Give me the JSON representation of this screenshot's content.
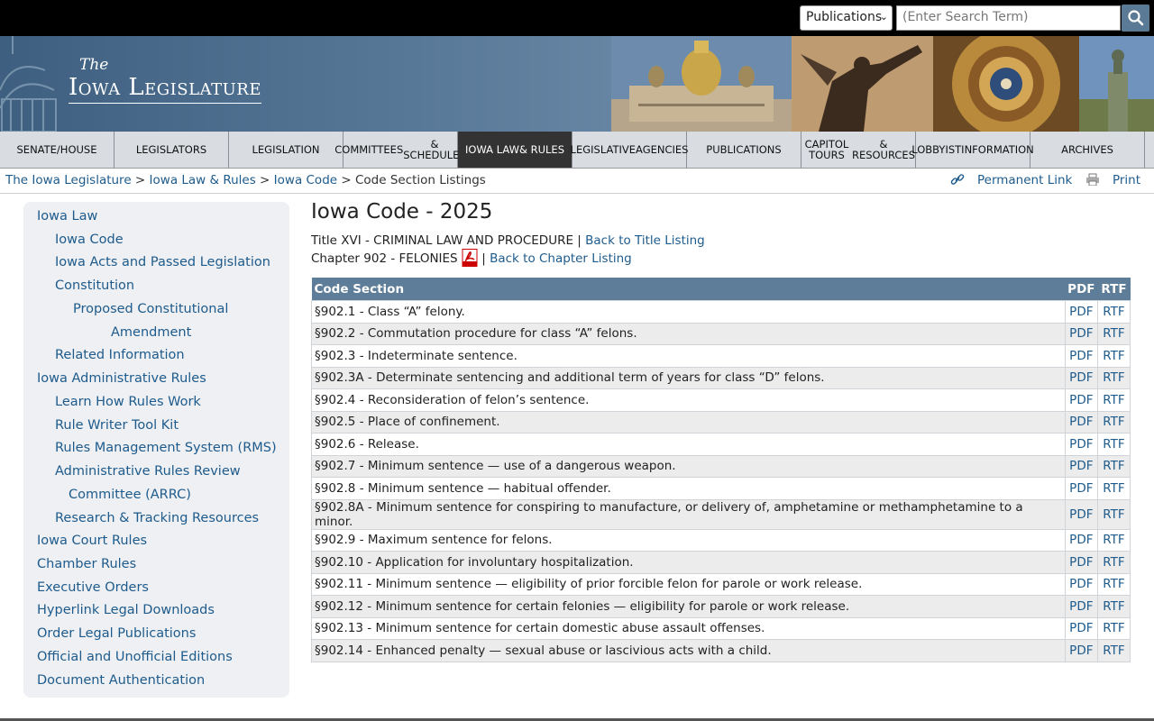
{
  "search": {
    "category": "Publications",
    "placeholder": "(Enter Search Term)"
  },
  "banner": {
    "logo_the": "The",
    "logo_main": "Iowa Legislature"
  },
  "nav": [
    {
      "line1": "Senate/House",
      "line2": ""
    },
    {
      "line1": "Legislators",
      "line2": ""
    },
    {
      "line1": "Legislation",
      "line2": ""
    },
    {
      "line1": "Committees",
      "line2": "& Schedules"
    },
    {
      "line1": "Iowa Law",
      "line2": "& Rules"
    },
    {
      "line1": "Legislative",
      "line2": "Agencies"
    },
    {
      "line1": "Publications",
      "line2": ""
    },
    {
      "line1": "Capitol Tours",
      "line2": "& Resources"
    },
    {
      "line1": "Lobbyist",
      "line2": "Information"
    },
    {
      "line1": "Archives",
      "line2": ""
    }
  ],
  "breadcrumb": {
    "items": [
      "The Iowa Legislature",
      "Iowa Law & Rules",
      "Iowa Code"
    ],
    "current": "Code Section Listings",
    "sep": ">"
  },
  "actions": {
    "permalink": "Permanent Link",
    "print": "Print"
  },
  "sidebar": [
    "Iowa Law",
    "Iowa Code",
    "Iowa Acts and Passed Legislation",
    "Constitution",
    "Proposed Constitutional",
    "Amendment",
    "Related Information",
    "Iowa Administrative Rules",
    "Learn How Rules Work",
    "Rule Writer Tool Kit",
    "Rules Management System (RMS)",
    "Administrative Rules Review",
    "Committee (ARRC)",
    "Research & Tracking Resources",
    "Iowa Court Rules",
    "Chamber Rules",
    "Executive Orders",
    "Hyperlink Legal Downloads",
    "Order Legal Publications",
    "Official and Unofficial Editions",
    "Document Authentication"
  ],
  "main": {
    "title": "Iowa Code - 2025",
    "title_line": "Title XVI - CRIMINAL LAW AND PROCEDURE |",
    "back_title": "Back to Title Listing",
    "chapter_line": "Chapter 902 - FELONIES",
    "back_chapter_sep": "|",
    "back_chapter": "Back to Chapter Listing",
    "table": {
      "headers": [
        "Code Section",
        "PDF",
        "RTF"
      ],
      "rows": [
        "§902.1 - Class “A” felony.",
        "§902.2 - Commutation procedure for class “A” felons.",
        "§902.3 - Indeterminate sentence.",
        "§902.3A - Determinate sentencing and additional term of years for class “D” felons.",
        "§902.4 - Reconsideration of felon’s sentence.",
        "§902.5 - Place of confinement.",
        "§902.6 - Release.",
        "§902.7 - Minimum sentence — use of a dangerous weapon.",
        "§902.8 - Minimum sentence — habitual offender.",
        "§902.8A - Minimum sentence for conspiring to manufacture, or delivery of, amphetamine or methamphetamine to a minor.",
        "§902.9 - Maximum sentence for felons.",
        "§902.10 - Application for involuntary hospitalization.",
        "§902.11 - Minimum sentence — eligibility of prior forcible felon for parole or work release.",
        "§902.12 - Minimum sentence for certain felonies — eligibility for parole or work release.",
        "§902.13 - Minimum sentence for certain domestic abuse assault offenses.",
        "§902.14 - Enhanced penalty — sexual abuse or lascivious acts with a child."
      ],
      "link_pdf": "PDF",
      "link_rtf": "RTF"
    }
  }
}
